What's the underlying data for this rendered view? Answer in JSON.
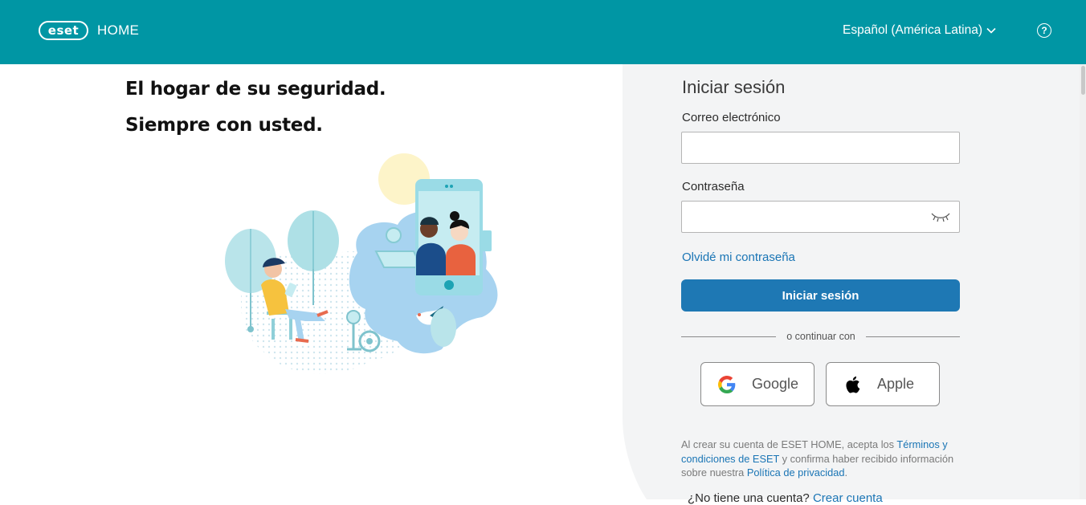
{
  "header": {
    "logo_text": "eset",
    "product_name": "HOME",
    "language": "Español (América Latina)",
    "help_symbol": "?",
    "background_color": "#0096a4"
  },
  "hero": {
    "line1": "El hogar de su seguridad.",
    "line2": "Siempre con usted."
  },
  "login": {
    "title": "Iniciar sesión",
    "email_label": "Correo electrónico",
    "email_value": "",
    "password_label": "Contraseña",
    "password_value": "",
    "forgot_link": "Olvidé mi contraseña",
    "submit_label": "Iniciar sesión",
    "or_continue": "o continuar con",
    "google_label": "Google",
    "apple_label": "Apple",
    "terms_prefix": "Al crear su cuenta de ESET HOME, acepta los ",
    "terms_link": "Términos y condiciones de ESET",
    "terms_middle": " y confirma haber recibido información sobre nuestra ",
    "privacy_link": "Política de privacidad",
    "terms_suffix": ".",
    "bottom_text": "¿No tiene una cuenta? ",
    "bottom_link": "Crear cuenta",
    "accent_color": "#1e78b4"
  },
  "icons": {
    "language_dropdown": "chevron-down-icon",
    "help": "help-circle-icon",
    "password_toggle": "eye-closed-icon",
    "google": "google-logo-icon",
    "apple": "apple-logo-icon"
  }
}
